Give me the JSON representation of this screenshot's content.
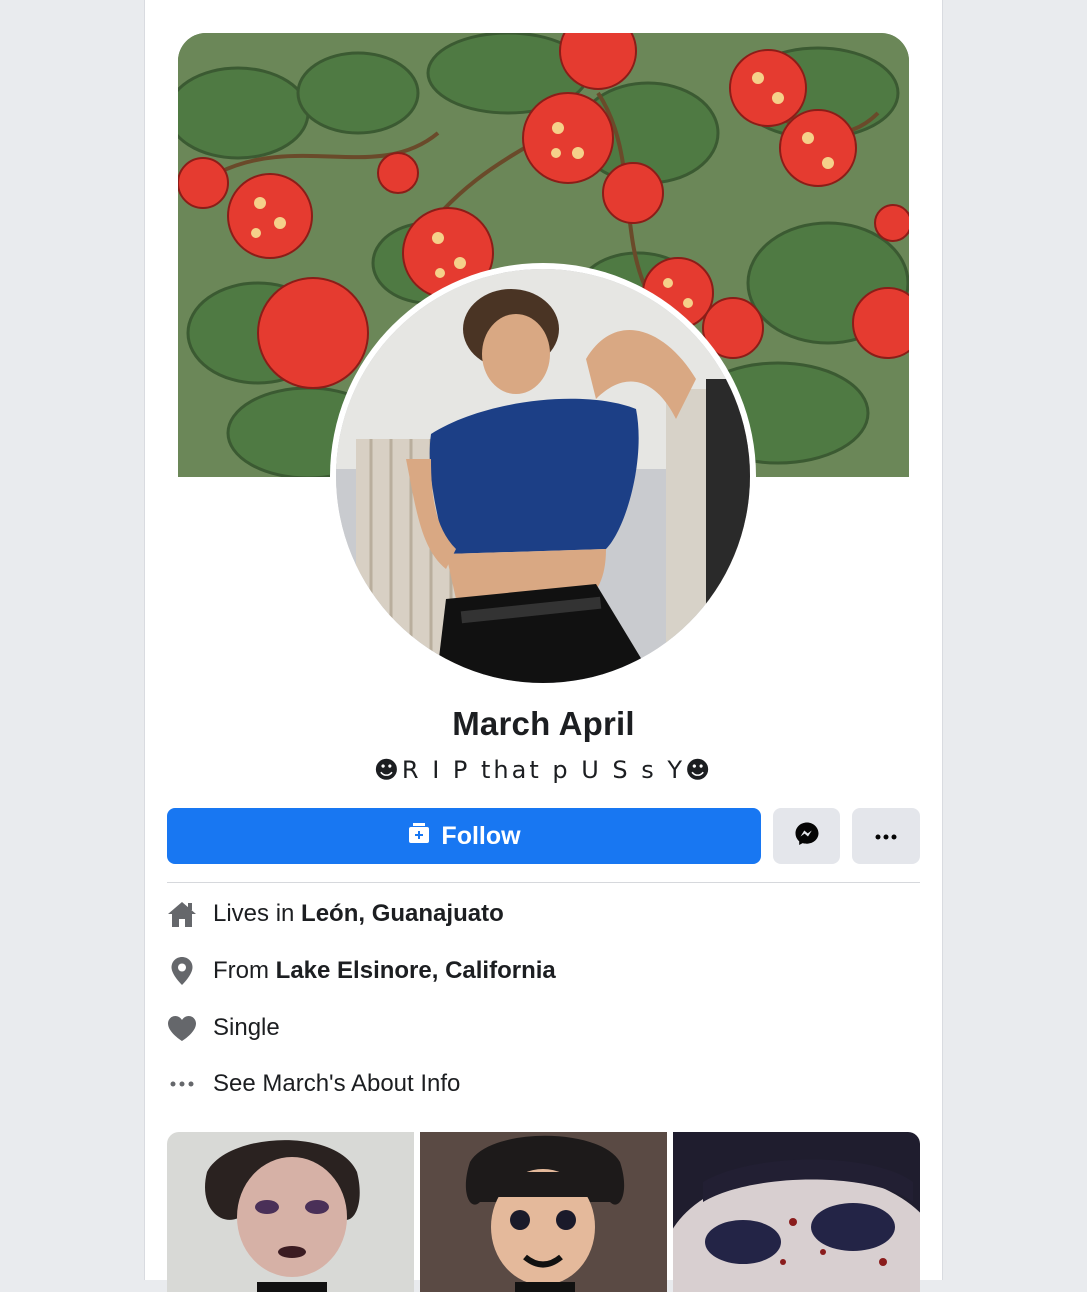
{
  "profile": {
    "name": "March April",
    "bio": "☻R I P  that  p U S s Y☻"
  },
  "actions": {
    "follow_label": "Follow"
  },
  "intro": {
    "lives_prefix": "Lives in ",
    "lives_value": "León, Guanajuato",
    "from_prefix": "From ",
    "from_value": "Lake Elsinore, California",
    "relationship": "Single",
    "about_link": "See March's About Info"
  },
  "icons": {
    "follow": "add-friend-icon",
    "message": "messenger-icon",
    "more": "more-dots-icon",
    "home": "home-icon",
    "location": "location-pin-icon",
    "relationship": "heart-icon",
    "about": "more-dots-icon"
  },
  "colors": {
    "accent": "#1877f2",
    "button_gray": "#e4e6eb",
    "icon_gray": "#65676b"
  }
}
